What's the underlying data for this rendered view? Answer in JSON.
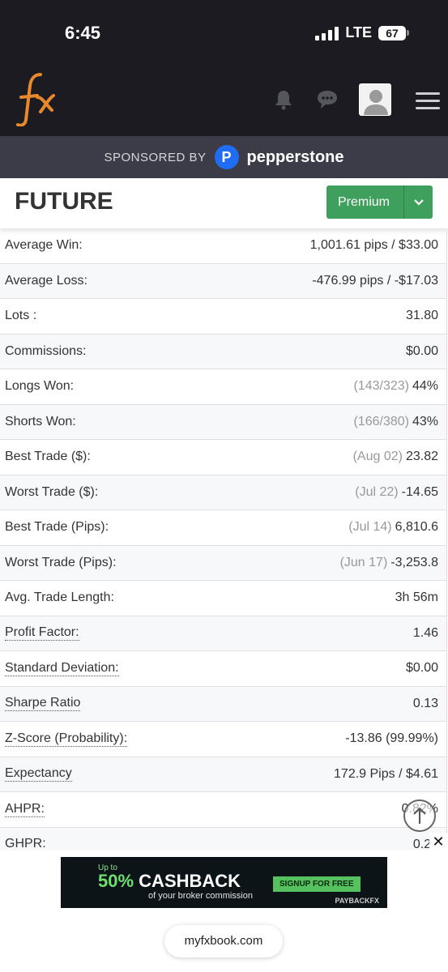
{
  "status_bar": {
    "time": "6:45",
    "network": "LTE",
    "battery": "67"
  },
  "header": {
    "logo_text": "fx",
    "icons": [
      "bell-icon",
      "chat-icon",
      "avatar",
      "menu-icon"
    ]
  },
  "sponsor": {
    "label": "SPONSORED BY",
    "brand": "pepperstone",
    "brand_mark": "P"
  },
  "page": {
    "title": "FUTURE",
    "premium_label": "Premium"
  },
  "stats": [
    {
      "label": "Average Win:",
      "value": "1,001.61 pips / $33.00",
      "note": "",
      "underline": false
    },
    {
      "label": "Average Loss:",
      "value": "-476.99 pips / -$17.03",
      "note": "",
      "underline": false
    },
    {
      "label": "Lots :",
      "value": "31.80",
      "note": "",
      "underline": false
    },
    {
      "label": "Commissions:",
      "value": "$0.00",
      "note": "",
      "underline": false
    },
    {
      "label": "Longs Won:",
      "value": "44%",
      "note": "(143/323)",
      "underline": false
    },
    {
      "label": "Shorts Won:",
      "value": "43%",
      "note": "(166/380)",
      "underline": false
    },
    {
      "label": "Best Trade ($):",
      "value": "23.82",
      "note": "(Aug 02)",
      "underline": false
    },
    {
      "label": "Worst Trade ($):",
      "value": "-14.65",
      "note": "(Jul 22)",
      "underline": false
    },
    {
      "label": "Best Trade (Pips):",
      "value": "6,810.6",
      "note": "(Jul 14)",
      "underline": false
    },
    {
      "label": "Worst Trade (Pips):",
      "value": "-3,253.8",
      "note": "(Jun 17)",
      "underline": false
    },
    {
      "label": "Avg. Trade Length:",
      "value": "3h 56m",
      "note": "",
      "underline": false
    },
    {
      "label": "Profit Factor:",
      "value": "1.46",
      "note": "",
      "underline": true
    },
    {
      "label": "Standard Deviation:",
      "value": "$0.00",
      "note": "",
      "underline": true
    },
    {
      "label": "Sharpe Ratio",
      "value": "0.13",
      "note": "",
      "underline": true
    },
    {
      "label": "Z-Score (Probability):",
      "value": "-13.86 (99.99%)",
      "note": "",
      "underline": true
    },
    {
      "label": "Expectancy",
      "value": "172.9 Pips / $4.61",
      "note": "",
      "underline": true
    },
    {
      "label": "AHPR:",
      "value": "0.82%",
      "note": "",
      "underline": true
    },
    {
      "label": "GHPR:",
      "value": "0.24",
      "note": "",
      "underline": true
    }
  ],
  "ad": {
    "upto": "Up to",
    "headline_pct": "50%",
    "headline_word": "CASHBACK",
    "subline": "of your broker commission",
    "button": "SIGNUP FOR FREE",
    "brand": "PAYBACKFX",
    "close": "✕"
  },
  "browser": {
    "url": "myfxbook.com"
  },
  "colors": {
    "accent_orange": "#e8892b",
    "premium_green": "#3f9f5c",
    "header_dark": "#1c1b21",
    "sponsor_bg": "#3b3c47",
    "pepperstone_blue": "#1f6df3"
  }
}
